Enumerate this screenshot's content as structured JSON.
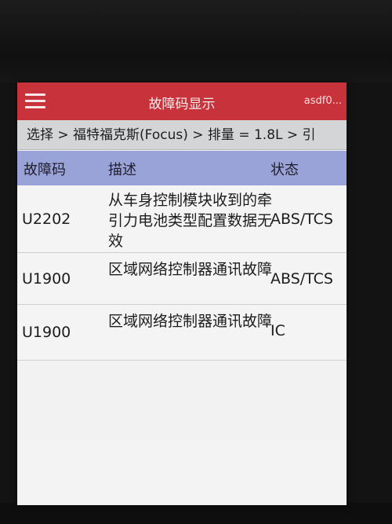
{
  "header": {
    "title": "故障码显示",
    "user": "asdf0..."
  },
  "breadcrumb": "选择 > 福特福克斯(Focus) > 排量 = 1.8L > 引",
  "table": {
    "columns": [
      "故障码",
      "描述",
      "状态"
    ],
    "rows": [
      {
        "code": "U2202",
        "description": "从车身控制模块收到的牵引力电池类型配置数据无效",
        "status": "ABS/TCS"
      },
      {
        "code": "U1900",
        "description": "区域网络控制器通讯故障",
        "status": "ABS/TCS"
      },
      {
        "code": "U1900",
        "description": "区域网络控制器通讯故障",
        "status": "IC"
      }
    ]
  },
  "colors": {
    "titlebar": "#c8323a",
    "header_row": "#9aa3d8"
  },
  "icons": {
    "menu": "hamburger-menu-icon"
  }
}
